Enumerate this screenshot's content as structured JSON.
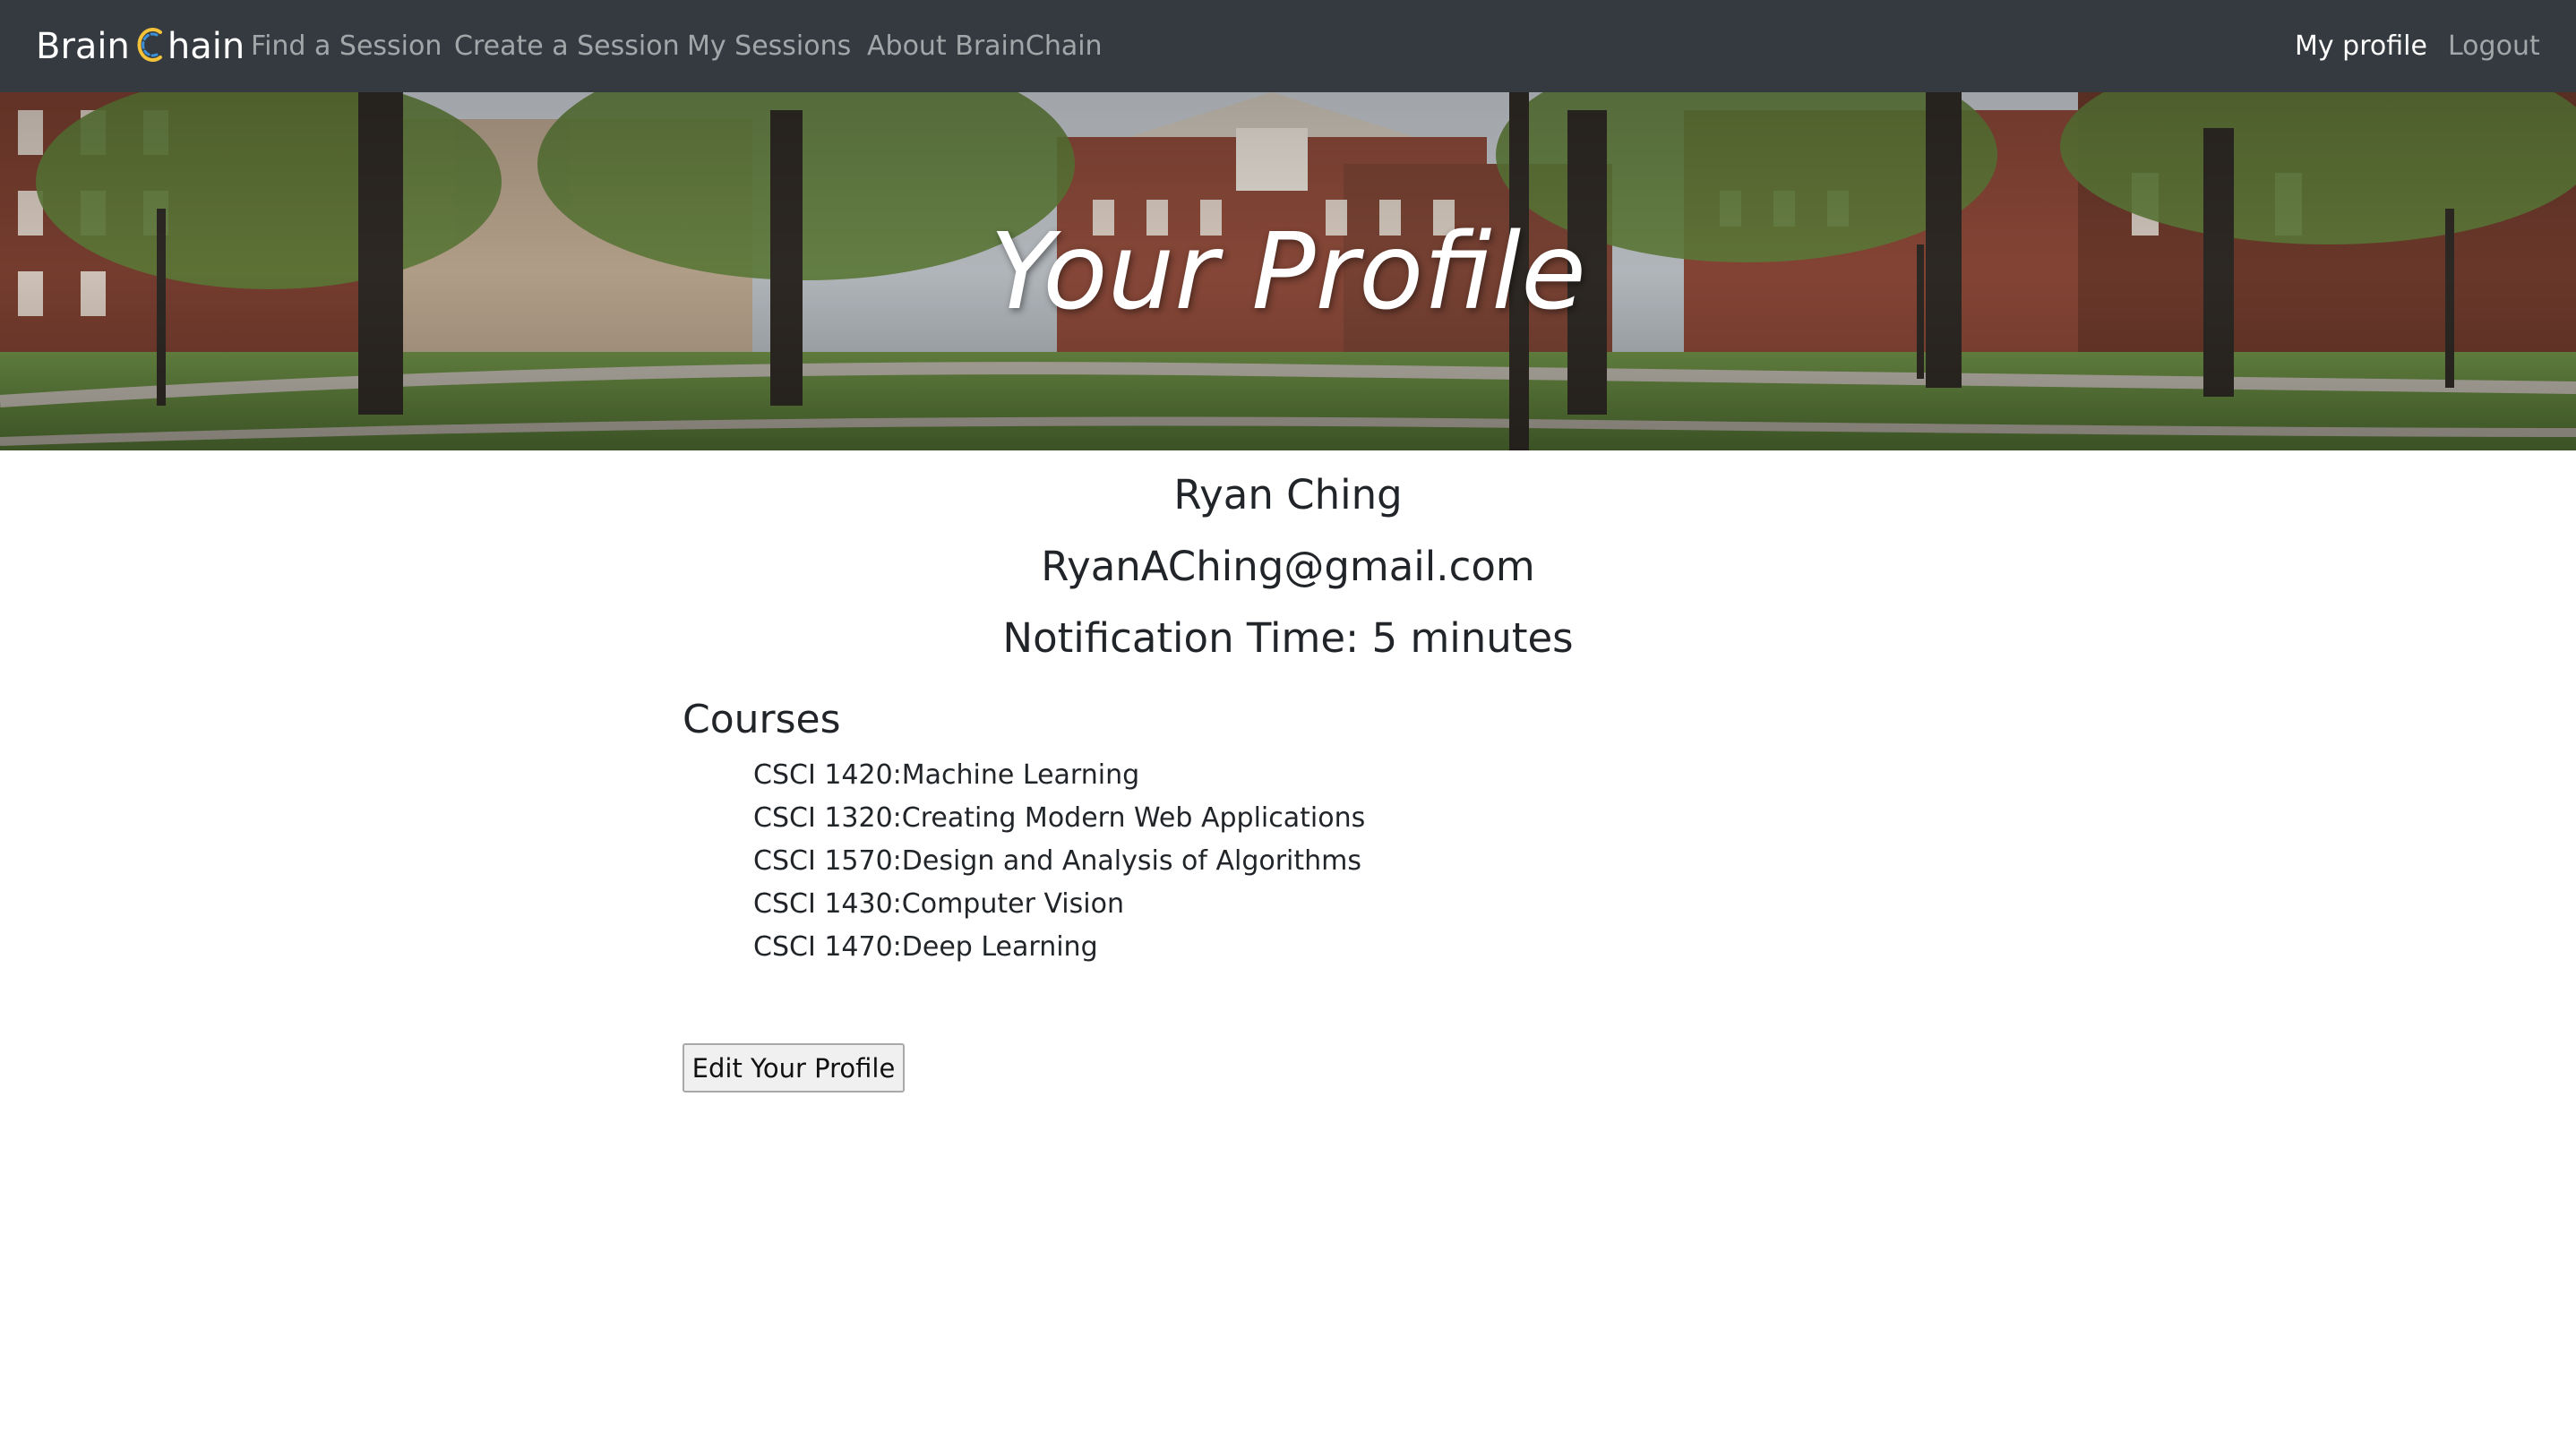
{
  "navbar": {
    "brand_prefix": "Brain",
    "brand_suffix": "hain",
    "brand_icon": "c-chain-logo-icon",
    "links": [
      "Find a Session",
      "Create a Session",
      "My Sessions",
      "About BrainChain"
    ],
    "right_links": [
      "My profile",
      "Logout"
    ]
  },
  "hero": {
    "title": "Your Profile",
    "background": "campus-photo"
  },
  "profile": {
    "name": "Ryan Ching",
    "email": "RyanAChing@gmail.com",
    "notification": "Notification Time: 5 minutes"
  },
  "courses": {
    "heading": "Courses",
    "items": [
      "CSCI 1420:Machine Learning",
      "CSCI 1320:Creating Modern Web Applications",
      "CSCI 1570:Design and Analysis of Algorithms",
      "CSCI 1430:Computer Vision",
      "CSCI 1470:Deep Learning"
    ]
  },
  "actions": {
    "edit_label": "Edit Your Profile"
  },
  "colors": {
    "navbar_bg": "#343a40",
    "nav_link": "#9a9da0",
    "nav_active": "#ffffff",
    "logo_blue": "#3d8fd6",
    "logo_yellow": "#f2c23a"
  }
}
